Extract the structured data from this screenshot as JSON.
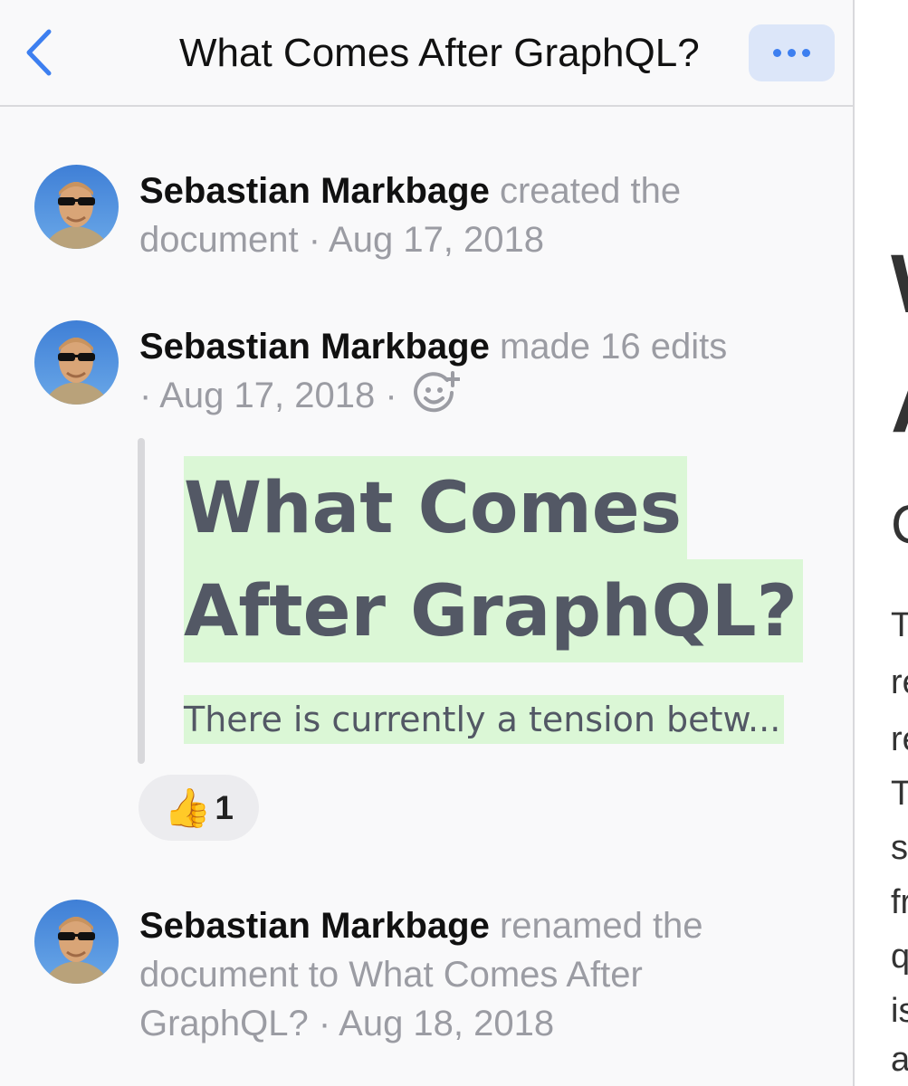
{
  "nav": {
    "title": "What Comes After GraphQL?",
    "back_icon": "chevron-left-icon",
    "more_icon": "more-horizontal-icon",
    "accent_color": "#3d7ff0"
  },
  "activity": [
    {
      "actor": "Sebastian Markbage",
      "action": "created the document",
      "date": "Aug 17, 2018"
    },
    {
      "actor": "Sebastian Markbage",
      "action": "made 16 edits",
      "date": "Aug 17, 2018",
      "add_reaction_icon": "add-reaction-icon",
      "diff": {
        "title_line1": "What Comes",
        "title_line2": "After GraphQL?",
        "excerpt": "There is currently a tension betw...",
        "highlight_color": "#dbf7d6"
      },
      "reaction": {
        "emoji": "👍",
        "count": "1"
      }
    },
    {
      "actor": "Sebastian Markbage",
      "action": "renamed the document to What Comes After GraphQL?",
      "date": "Aug 18, 2018"
    }
  ],
  "right_pane": {
    "lines": [
      "W",
      "A",
      "C",
      "T",
      "re",
      "re",
      "T",
      "s",
      "fr",
      "q",
      "is",
      "a"
    ]
  }
}
